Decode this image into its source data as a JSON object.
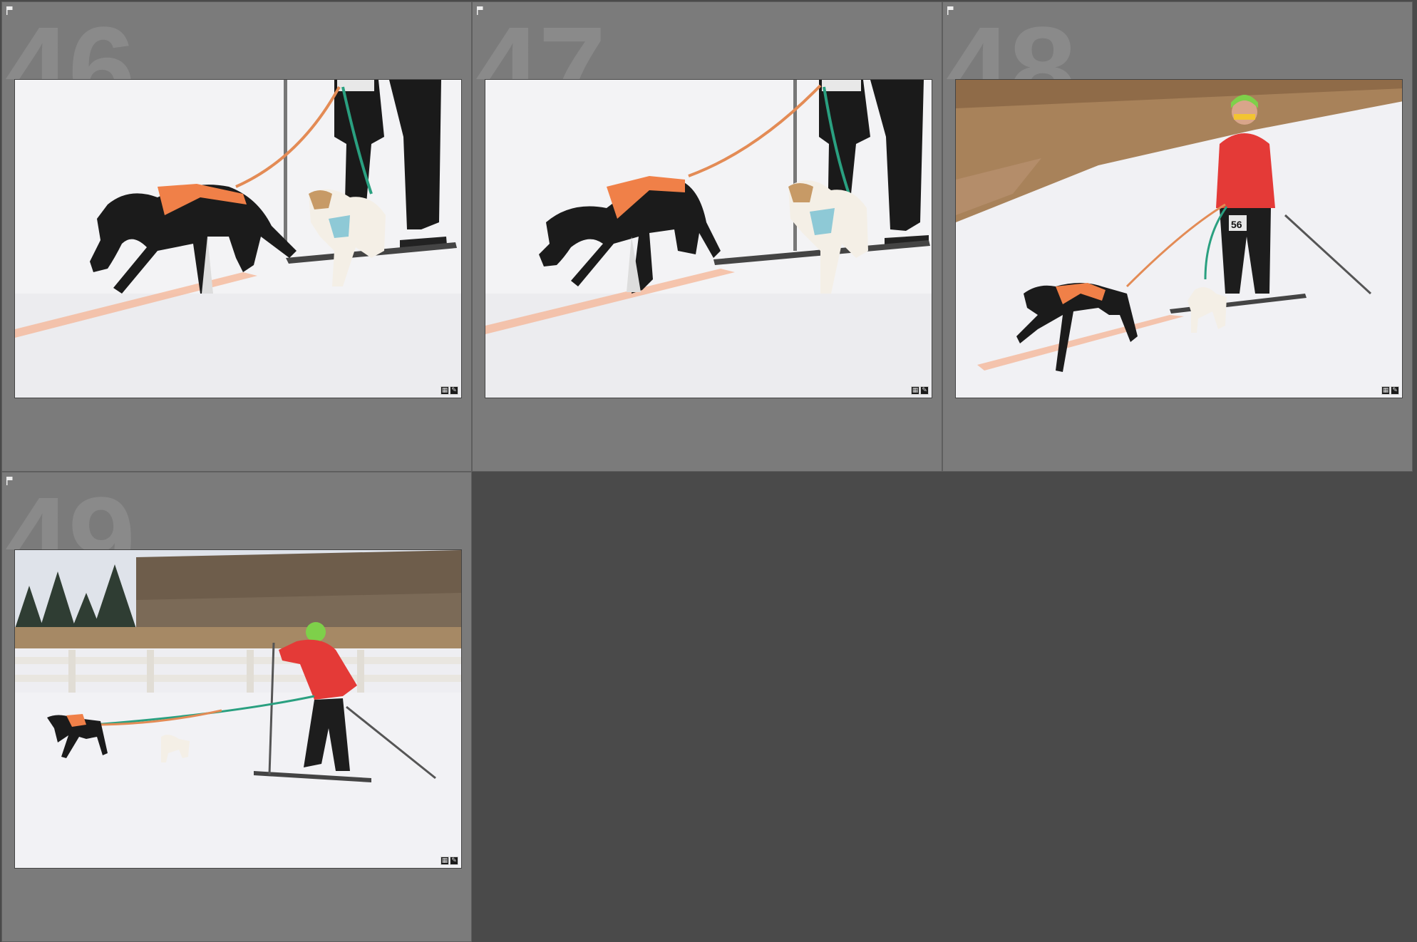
{
  "grid": {
    "background_color": "#4a4a4a",
    "cell_color": "#7b7b7b",
    "cells": [
      {
        "index": "46",
        "bib": "",
        "flag_icon": "flag-icon",
        "badge_icons": [
          "metadata-icon",
          "edit-icon"
        ]
      },
      {
        "index": "47",
        "bib": "",
        "flag_icon": "flag-icon",
        "badge_icons": [
          "metadata-icon",
          "edit-icon"
        ]
      },
      {
        "index": "48",
        "bib": "56",
        "flag_icon": "flag-icon",
        "badge_icons": [
          "metadata-icon",
          "edit-icon"
        ]
      },
      {
        "index": "49",
        "bib": "",
        "flag_icon": "flag-icon",
        "badge_icons": [
          "metadata-icon",
          "edit-icon"
        ]
      }
    ]
  }
}
